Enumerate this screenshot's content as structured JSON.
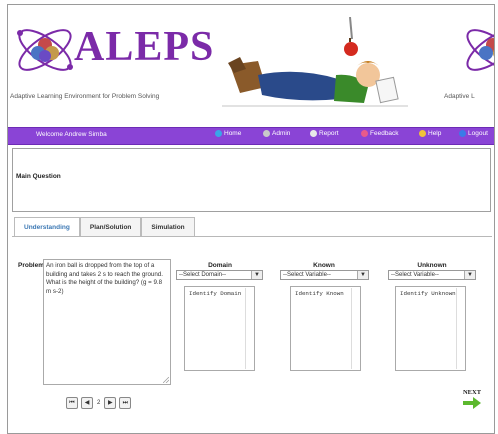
{
  "header": {
    "logo_text": "ALEPS",
    "tagline": "Adaptive Learning Environment for Problem Solving",
    "tagline_repeat": "Adaptive L"
  },
  "navbar": {
    "welcome": "Welcome Andrew Simba",
    "items": [
      {
        "label": "Home",
        "icon": "home-icon",
        "color": "#3aa6e8"
      },
      {
        "label": "Admin",
        "icon": "admin-icon",
        "color": "#c9c9c9"
      },
      {
        "label": "Report",
        "icon": "report-icon",
        "color": "#e8e8e8"
      },
      {
        "label": "Feedback",
        "icon": "feedback-icon",
        "color": "#e85a8c"
      },
      {
        "label": "Help",
        "icon": "help-icon",
        "color": "#f0c23a"
      },
      {
        "label": "Logout",
        "icon": "logout-icon",
        "color": "#3a7be8"
      }
    ]
  },
  "main_question": {
    "label": "Main Question"
  },
  "tabs": [
    {
      "label": "Understanding",
      "active": true
    },
    {
      "label": "Plan/Solution",
      "active": false
    },
    {
      "label": "Simulation",
      "active": false
    }
  ],
  "problem": {
    "label": "Problem",
    "text": "An iron ball is dropped from the top of a building and takes 2 s to reach the ground. What is the height of the building? (g = 9.8 m s-2)"
  },
  "columns": [
    {
      "heading": "Domain",
      "select": "--Select Domain--",
      "list_item": "Identify Domain"
    },
    {
      "heading": "Known",
      "select": "--Select Variable--",
      "list_item": "Identify Known"
    },
    {
      "heading": "Unknown",
      "select": "--Select Variable--",
      "list_item": "Identify Unknown"
    }
  ],
  "pager": {
    "page": "2"
  },
  "next": {
    "label": "NEXT"
  },
  "colors": {
    "nav_bg": "#8a44d6",
    "logo": "#7b2aa8",
    "tab_active_text": "#3c78b4",
    "next_arrow": "#5cb82e"
  }
}
